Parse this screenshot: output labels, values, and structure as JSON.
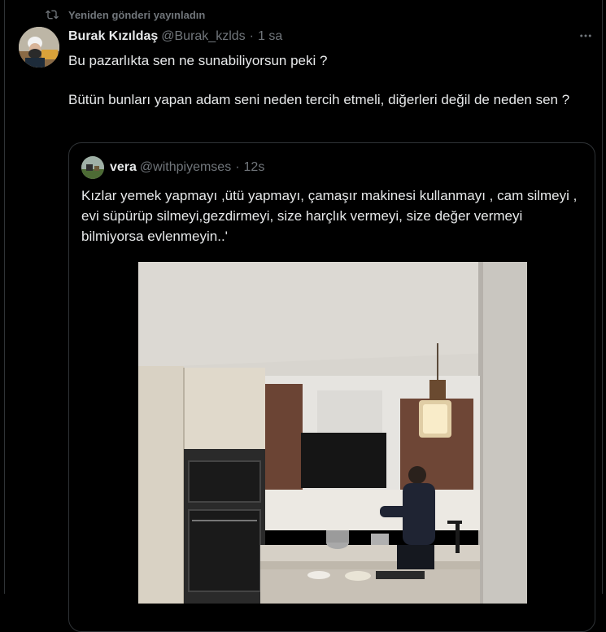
{
  "repost": {
    "label": "Yeniden gönderi yayınladın",
    "icon": "repost-icon"
  },
  "tweet": {
    "display_name": "Burak Kızıldaş",
    "handle": "@Burak_kzlds",
    "separator": "·",
    "time": "1 sa",
    "text": "Bu pazarlıkta sen ne sunabiliyorsun peki ?\n\nBütün bunları yapan adam seni neden tercih etmeli, diğerleri değil de neden sen ?",
    "more_icon": "more-options-icon"
  },
  "quote": {
    "display_name": "vera",
    "handle": "@withpiyemses",
    "separator": "·",
    "time": "12s",
    "text": "Kızlar yemek yapmayı ,ütü yapmayı, çamaşır makinesi kullanmayı , cam silmeyi , evi süpürüp silmeyi,gezdirmeyi, size harçlık vermeyi, size değer vermeyi  bilmiyorsa evlenmeyin..'"
  },
  "colors": {
    "background": "#000000",
    "text_primary": "#e7e9ea",
    "text_secondary": "#71767b",
    "border": "#2f3336"
  }
}
